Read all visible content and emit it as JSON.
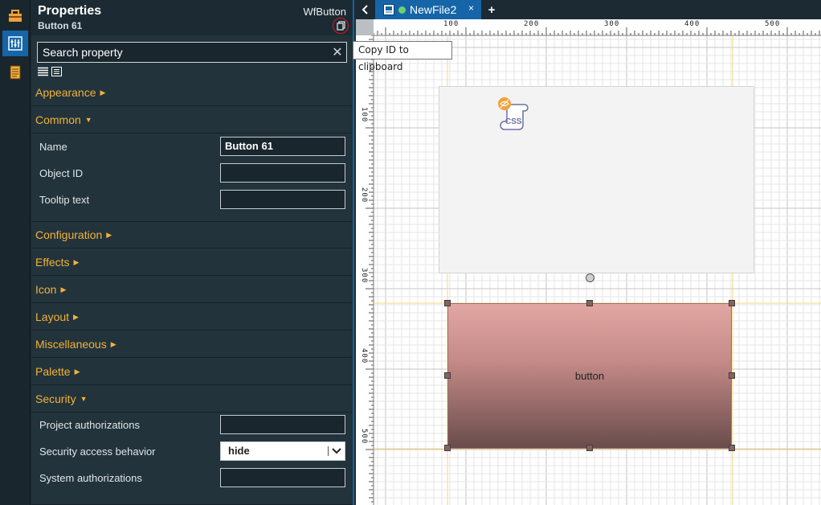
{
  "panel": {
    "title": "Properties",
    "subtitle": "Button 61",
    "type": "WfButton",
    "copy_tooltip": "Copy ID to clipboard",
    "search_placeholder": "Search property"
  },
  "categories": {
    "appearance": "Appearance",
    "common": "Common",
    "configuration": "Configuration",
    "effects": "Effects",
    "icon": "Icon",
    "layout": "Layout",
    "miscellaneous": "Miscellaneous",
    "palette": "Palette",
    "security": "Security"
  },
  "common_props": {
    "name_label": "Name",
    "name_value": "Button 61",
    "objectid_label": "Object ID",
    "objectid_value": "",
    "tooltip_label": "Tooltip text",
    "tooltip_value": ""
  },
  "security_props": {
    "project_auth_label": "Project authorizations",
    "project_auth_value": "",
    "access_behavior_label": "Security access behavior",
    "access_behavior_value": "hide",
    "system_auth_label": "System authorizations",
    "system_auth_value": ""
  },
  "tabs": {
    "file_name": "NewFile2",
    "close": "×",
    "add": "+"
  },
  "rulers": {
    "h": [
      "100",
      "200",
      "300",
      "400",
      "500"
    ],
    "v": [
      "100",
      "200",
      "300",
      "400",
      "500"
    ]
  },
  "canvas": {
    "css_label": "CSS",
    "button_label": "button"
  },
  "colors": {
    "accent": "#1565a8",
    "category": "#f2b23a",
    "copy_highlight": "#e0151b"
  }
}
